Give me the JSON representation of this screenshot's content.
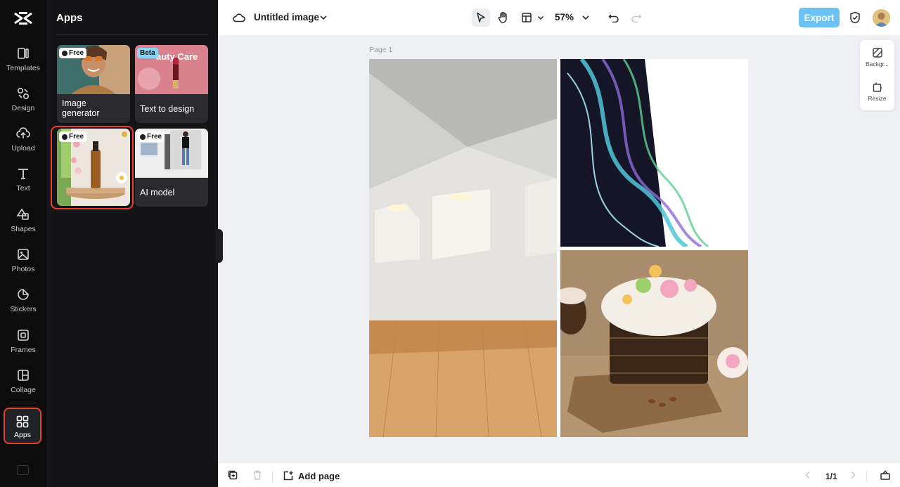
{
  "rail": {
    "items": [
      {
        "label": "Templates",
        "icon": "templates-icon"
      },
      {
        "label": "Design",
        "icon": "design-icon"
      },
      {
        "label": "Upload",
        "icon": "upload-icon"
      },
      {
        "label": "Text",
        "icon": "text-icon"
      },
      {
        "label": "Shapes",
        "icon": "shapes-icon"
      },
      {
        "label": "Photos",
        "icon": "photos-icon"
      },
      {
        "label": "Stickers",
        "icon": "stickers-icon"
      },
      {
        "label": "Frames",
        "icon": "frames-icon"
      },
      {
        "label": "Collage",
        "icon": "collage-icon"
      },
      {
        "label": "Apps",
        "icon": "apps-icon",
        "active": true
      }
    ]
  },
  "panel": {
    "title": "Apps",
    "cards": [
      {
        "title": "Image generator",
        "badge": "Free"
      },
      {
        "title": "Text to design",
        "badge": "Beta",
        "thumb_text": "auty Care"
      },
      {
        "title": "",
        "badge": "Free",
        "selected": true
      },
      {
        "title": "AI model",
        "badge": "Free"
      }
    ]
  },
  "topbar": {
    "doc_title": "Untitled image",
    "zoom": "57%",
    "export_label": "Export"
  },
  "canvas": {
    "page_label": "Page 1"
  },
  "side_panel": {
    "background_label": "Backgr...",
    "resize_label": "Resize"
  },
  "bottombar": {
    "add_page_label": "Add page",
    "pager": "1/1"
  },
  "colors": {
    "accent": "#6cc2f5",
    "highlight": "#e8402f",
    "rail_bg": "#0c0c0d",
    "panel_bg": "#141416"
  }
}
